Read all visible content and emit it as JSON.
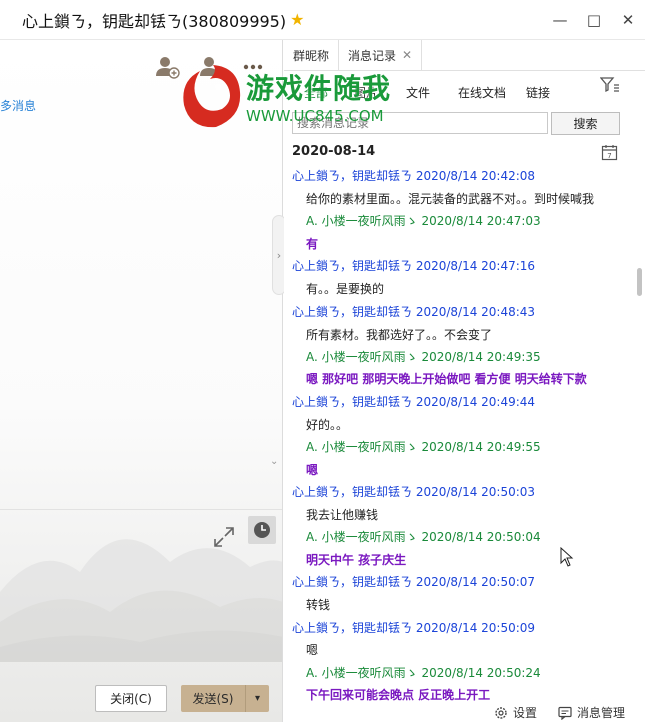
{
  "window": {
    "title": "心上鎖ㄋ，钥匙却铥ㄋ(380809995)",
    "controls": [
      "—",
      "□",
      "✕"
    ]
  },
  "left": {
    "more_messages": "多消息",
    "close_label": "关闭(C)",
    "send_label": "发送(S)"
  },
  "tabs": [
    {
      "label": "群昵称",
      "active": false
    },
    {
      "label": "消息记录",
      "active": true
    }
  ],
  "filters": [
    "全部",
    "图片",
    "文件",
    "在线文档",
    "链接"
  ],
  "search": {
    "placeholder": "搜索消息记录",
    "button": "搜索"
  },
  "date_header": "2020-08-14",
  "messages": [
    {
      "type": "sender",
      "text": "心上鎖ㄋ，钥匙却铥ㄋ 2020/8/14 20:42:08"
    },
    {
      "type": "body",
      "text": "给你的素材里面。。混元装备的武器不对。。到时候喊我"
    },
    {
      "type": "reply-sender",
      "text": "A.   小楼一夜听风雨ゝ 2020/8/14 20:47:03"
    },
    {
      "type": "reply-body",
      "text": "有"
    },
    {
      "type": "sender",
      "text": "心上鎖ㄋ，钥匙却铥ㄋ 2020/8/14 20:47:16"
    },
    {
      "type": "body",
      "text": "有。。是要换的"
    },
    {
      "type": "sender",
      "text": "心上鎖ㄋ，钥匙却铥ㄋ 2020/8/14 20:48:43"
    },
    {
      "type": "body",
      "text": "所有素材。我都选好了。。不会变了"
    },
    {
      "type": "reply-sender",
      "text": "A.   小楼一夜听风雨ゝ 2020/8/14 20:49:35"
    },
    {
      "type": "reply-body",
      "text": "嗯    那好吧    那明天晚上开始做吧    看方便  明天给转下款"
    },
    {
      "type": "sender",
      "text": "心上鎖ㄋ，钥匙却铥ㄋ 2020/8/14 20:49:44"
    },
    {
      "type": "body",
      "text": "好的。。"
    },
    {
      "type": "reply-sender",
      "text": "A.   小楼一夜听风雨ゝ 2020/8/14 20:49:55"
    },
    {
      "type": "reply-body",
      "text": "嗯"
    },
    {
      "type": "sender",
      "text": "心上鎖ㄋ，钥匙却铥ㄋ 2020/8/14 20:50:03"
    },
    {
      "type": "body",
      "text": "我去让他赚钱"
    },
    {
      "type": "reply-sender",
      "text": "A.   小楼一夜听风雨ゝ 2020/8/14 20:50:04"
    },
    {
      "type": "reply-body",
      "text": "明天中午   孩子庆生"
    },
    {
      "type": "sender",
      "text": "心上鎖ㄋ，钥匙却铥ㄋ 2020/8/14 20:50:07"
    },
    {
      "type": "body",
      "text": "转钱"
    },
    {
      "type": "sender",
      "text": "心上鎖ㄋ，钥匙却铥ㄋ 2020/8/14 20:50:09"
    },
    {
      "type": "body",
      "text": "嗯"
    },
    {
      "type": "reply-sender",
      "text": "A.   小楼一夜听风雨ゝ 2020/8/14 20:50:24"
    },
    {
      "type": "reply-body",
      "text": "下午回来可能会晚点   反正晚上开工"
    }
  ],
  "bottom": {
    "settings": "设置",
    "manage": "消息管理"
  },
  "watermark": {
    "title": "游戏件随我",
    "url": "WWW.UC845.COM"
  },
  "colors": {
    "sender": "#1c44d8",
    "reply_sender": "#1a8a3a",
    "reply_body": "#7a18c0",
    "send_button": "#c7b191",
    "star": "#f1b400"
  }
}
